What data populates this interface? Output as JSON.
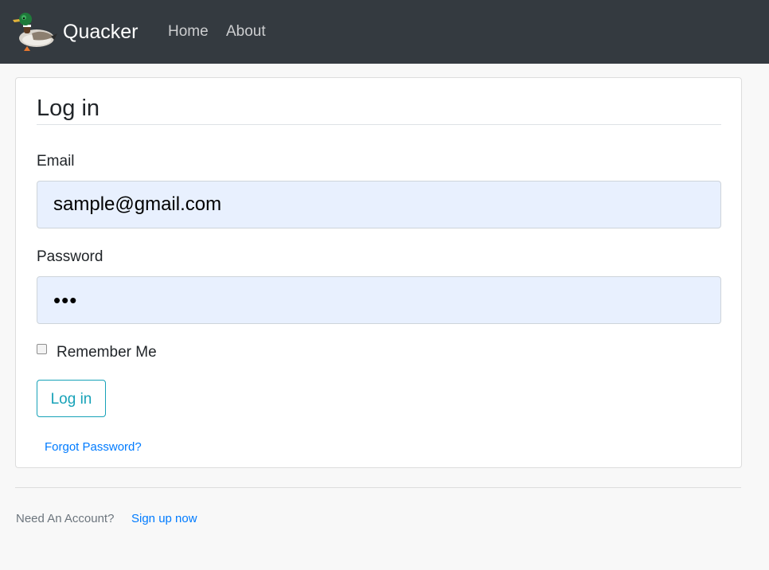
{
  "navbar": {
    "brand": "Quacker",
    "logo_icon": "duck-logo-icon",
    "links": [
      {
        "label": "Home"
      },
      {
        "label": "About"
      }
    ]
  },
  "login_card": {
    "title": "Log in",
    "email": {
      "label": "Email",
      "value": "sample@gmail.com"
    },
    "password": {
      "label": "Password",
      "value": "•••"
    },
    "remember_me": {
      "label": "Remember Me",
      "checked": false
    },
    "submit_label": "Log in",
    "forgot_password_label": "Forgot Password?"
  },
  "footer": {
    "prompt": "Need An Account?",
    "signup_label": "Sign up now"
  },
  "colors": {
    "navbar_bg": "#343a40",
    "autofill_bg": "#e8f0fe",
    "button_accent": "#17a2b8",
    "link": "#007bff",
    "page_bg": "#f8f8f8"
  }
}
